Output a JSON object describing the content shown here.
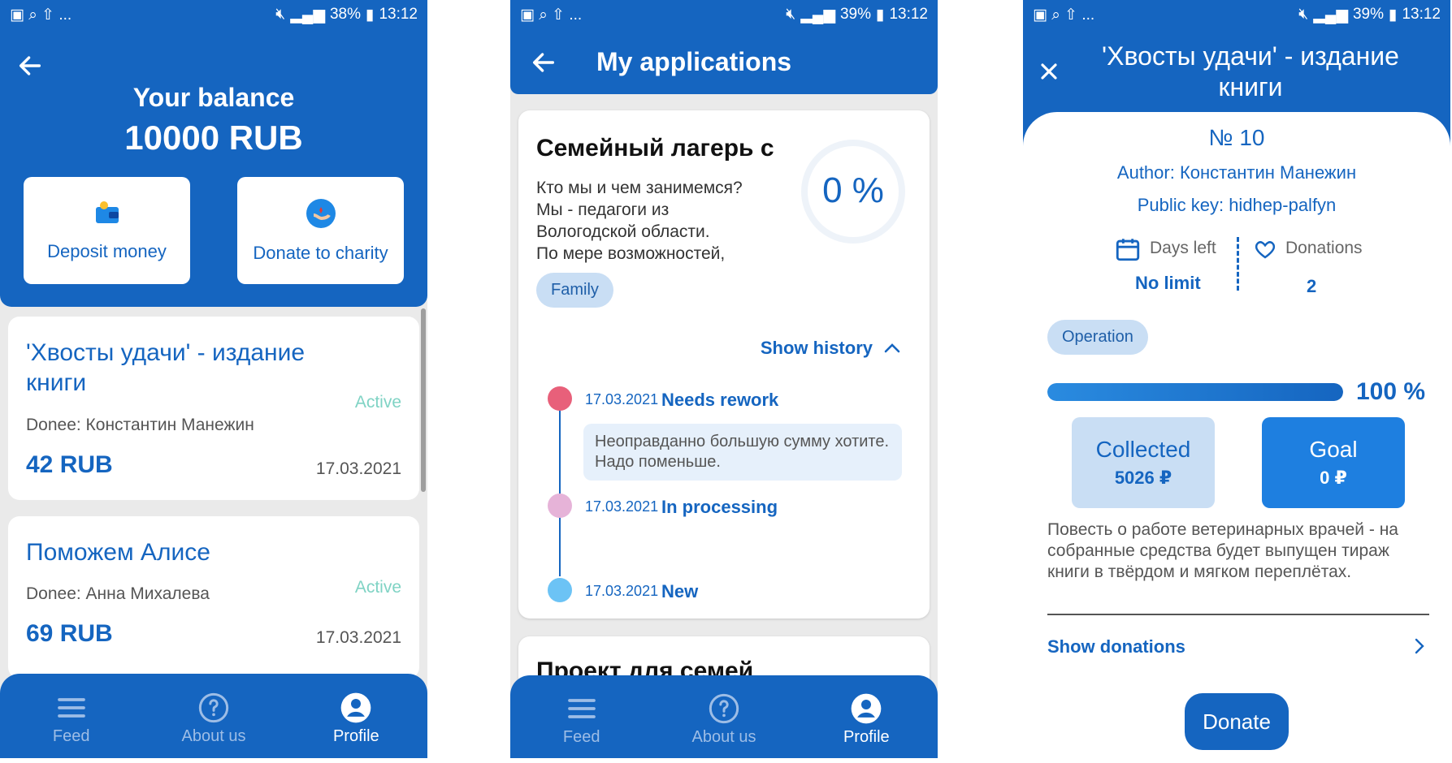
{
  "status1": {
    "left_icons": "▣ ⌕ ⇧ ...",
    "battery": "38%",
    "time": "13:12"
  },
  "status2": {
    "left_icons": "▣ ⌕ ⇧ ...",
    "battery": "39%",
    "time": "13:12"
  },
  "status3": {
    "left_icons": "▣ ⌕ ⇧ ...",
    "battery": "39%",
    "time": "13:12"
  },
  "balance": {
    "title": "Your balance",
    "amount": "10000 RUB",
    "deposit_label": "Deposit money",
    "donate_label": "Donate to charity",
    "items": [
      {
        "title": "'Хвосты удачи' - издание книги",
        "status": "Active",
        "donee": "Donee: Константин Манежин",
        "amount": "42 RUB",
        "date": "17.03.2021"
      },
      {
        "title": "Поможем Алисе",
        "status": "Active",
        "donee": "Donee: Анна Михалева",
        "amount": "69 RUB",
        "date": "17.03.2021"
      }
    ]
  },
  "applications": {
    "title": "My applications",
    "card": {
      "title": "Семейный лагерь с",
      "description": [
        "Кто мы и чем занимемся?",
        "Мы - педагоги из",
        "Вологодской области.",
        "По мере возможностей,"
      ],
      "percent": "0 %",
      "percent_value": 0,
      "tag": "Family",
      "show_history": "Show history",
      "history": [
        {
          "date": "17.03.2021",
          "status": "Needs rework",
          "comment": "Неоправданно большую сумму хотите. Надо поменьше.",
          "color": "#e8607a"
        },
        {
          "date": "17.03.2021",
          "status": "In processing",
          "color": "#e6b3d8"
        },
        {
          "date": "17.03.2021",
          "status": "New",
          "color": "#6cc3f5"
        }
      ]
    },
    "next_card_title": "Проект для семей"
  },
  "nav": {
    "feed": "Feed",
    "about": "About us",
    "profile": "Profile"
  },
  "project": {
    "title_line1": "'Хвосты удачи' - издание",
    "title_line2": "книги",
    "number": "№ 10",
    "author": "Author: Константин Манежин",
    "public_key": "Public key: hidhep-palfyn",
    "days_left_label": "Days left",
    "days_left_value": "No limit",
    "donations_label": "Donations",
    "donations_value": "2",
    "tag": "Operation",
    "progress_value": 100,
    "progress_label": "100 %",
    "collected_label": "Collected",
    "collected_value": "5026 ₽",
    "goal_label": "Goal",
    "goal_value": "0 ₽",
    "description": "Повесть о работе ветеринарных врачей - на собранные средства будет выпущен тираж книги в твёрдом и мягком переплётах.",
    "show_donations": "Show donations",
    "donate_button": "Donate"
  },
  "colors": {
    "primary": "#1565c0",
    "active_status": "#7fd3c4",
    "light_tag": "#c9def4"
  }
}
